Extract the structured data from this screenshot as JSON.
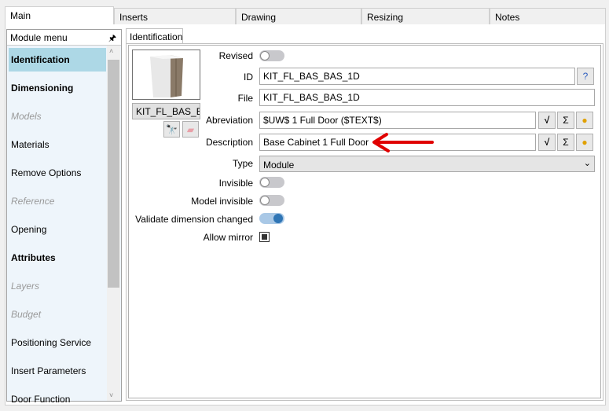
{
  "tabs": [
    "Main",
    "Inserts",
    "Drawing",
    "Resizing",
    "Notes"
  ],
  "sidebar": {
    "title": "Module menu",
    "items": [
      {
        "label": "Identification",
        "style": "selected"
      },
      {
        "label": "Dimensioning",
        "style": "bold"
      },
      {
        "label": "Models",
        "style": "disabled"
      },
      {
        "label": "Materials",
        "style": "normal"
      },
      {
        "label": "Remove Options",
        "style": "normal"
      },
      {
        "label": "Reference",
        "style": "disabled"
      },
      {
        "label": "Opening",
        "style": "normal"
      },
      {
        "label": "Attributes",
        "style": "bold"
      },
      {
        "label": "Layers",
        "style": "disabled"
      },
      {
        "label": "Budget",
        "style": "disabled"
      },
      {
        "label": "Positioning Service",
        "style": "normal"
      },
      {
        "label": "Insert Parameters",
        "style": "normal"
      },
      {
        "label": "Door Function",
        "style": "normal"
      }
    ]
  },
  "subtab": "Identification",
  "preview": {
    "name": "KIT_FL_BAS_E"
  },
  "form": {
    "revised": {
      "label": "Revised",
      "on": false
    },
    "id": {
      "label": "ID",
      "value": "KIT_FL_BAS_BAS_1D"
    },
    "file": {
      "label": "File",
      "value": "KIT_FL_BAS_BAS_1D"
    },
    "abbreviation": {
      "label": "Abreviation",
      "value": "$UW$ 1 Full Door ($TEXT$)"
    },
    "description": {
      "label": "Description",
      "value": "Base Cabinet 1 Full Door"
    },
    "type": {
      "label": "Type",
      "value": "Module"
    },
    "invisible": {
      "label": "Invisible",
      "on": false
    },
    "model_invisible": {
      "label": "Model invisible",
      "on": false
    },
    "validate": {
      "label": "Validate dimension changed",
      "on": true
    },
    "allow_mirror": {
      "label": "Allow mirror",
      "checked": true
    }
  },
  "glyphs": {
    "sigma": "Σ",
    "pin": "📌"
  },
  "colors": {
    "accent": "#2f75b5",
    "selected": "#add8e6",
    "arrow": "#e00000"
  }
}
